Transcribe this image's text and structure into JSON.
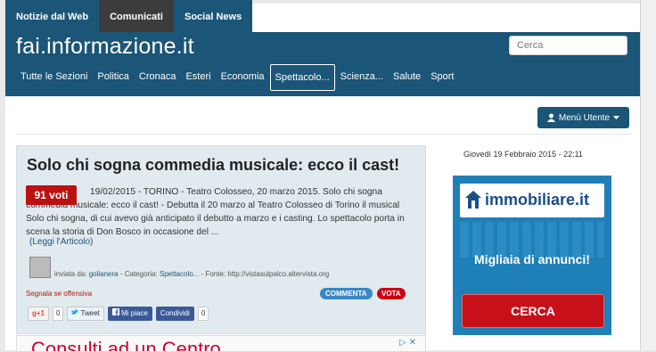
{
  "top_tabs": [
    {
      "label": "Notizie dal Web"
    },
    {
      "label": "Comunicati"
    },
    {
      "label": "Social News"
    }
  ],
  "site": {
    "logo": "fai.informazione.it"
  },
  "search": {
    "placeholder": "Cerca"
  },
  "nav": [
    {
      "label": "Tutte le Sezioni"
    },
    {
      "label": "Politica"
    },
    {
      "label": "Cronaca"
    },
    {
      "label": "Esteri"
    },
    {
      "label": "Economia"
    },
    {
      "label": "Spettacolo..."
    },
    {
      "label": "Scienza..."
    },
    {
      "label": "Salute"
    },
    {
      "label": "Sport"
    }
  ],
  "user_menu": {
    "label": "Menù Utente"
  },
  "article": {
    "title": "Solo chi sogna commedia musicale: ecco il cast!",
    "votes": "91 voti",
    "body": "19/02/2015 - TORINO - Teatro Colosseo, 20 marzo 2015. Solo chi sogna commedia musicale: ecco il cast! - Debutta il 20 marzo al Teatro Colosseo di Torino il musical Solo chi sogna, di cui avevo già anticipato il debutto a marzo e i casting. Lo spettacolo porta in scena la storia di Don Bosco in occasione del ...",
    "read_more": "(Leggi l'Articolo)",
    "meta_prefix": "inviata da: ",
    "author": "golianera",
    "meta_mid": " - Categoria: ",
    "category": "Spettacolo...",
    "meta_suffix": " - Fonte: http://vistasulpalco.altervista.org",
    "report": "Segnala se offensiva",
    "comment_btn": "COMMENTA",
    "vote_btn": "VOTA",
    "social": {
      "gplus": "g+1",
      "gplus_count": "0",
      "tweet": "Tweet",
      "like": "Mi piace",
      "share": "Condividi",
      "share_count": "0"
    }
  },
  "sidebar": {
    "date": "Giovedì 19 Febbraio 2015 - 22:11",
    "banner": {
      "logo": "immobiliare.it",
      "tagline": "Migliaia di annunci!",
      "cta": "CERCA"
    }
  },
  "ad": {
    "text": "Consulti ad un Centro"
  },
  "colors": {
    "primary": "#1b5577",
    "accent": "#c01010",
    "button_blue": "#3a87c6"
  }
}
